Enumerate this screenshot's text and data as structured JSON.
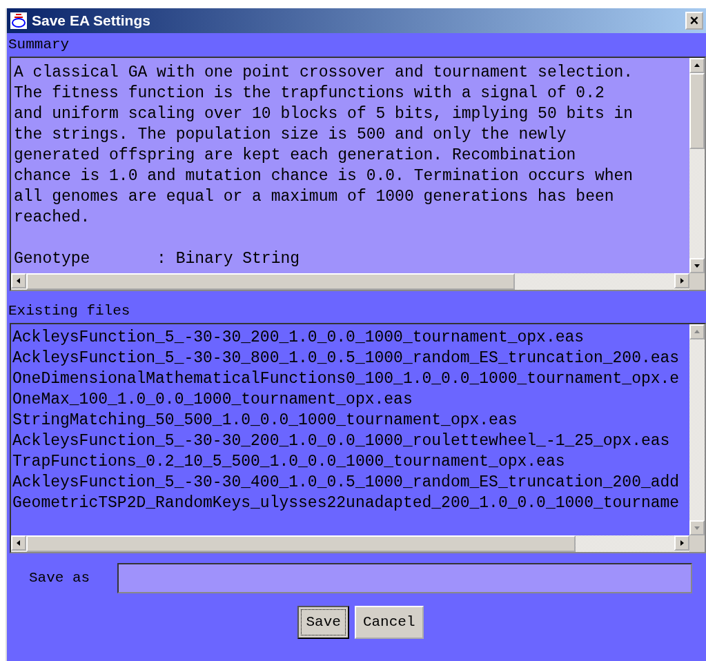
{
  "window": {
    "title": "Save EA Settings",
    "close": "×"
  },
  "summary": {
    "label": "Summary",
    "blocks": [
      [
        "A classical GA with one point crossover and tournament selection.",
        "The fitness function is the trapfunctions with a signal of 0.2",
        "and uniform scaling over 10 blocks of 5 bits, implying 50 bits in",
        "the strings. The population size is 500 and only the newly",
        "generated offspring are kept each generation. Recombination",
        "chance is 1.0 and mutation chance is 0.0. Termination occurs when",
        "all genomes are equal or a maximum of 1000 generations has been",
        "reached."
      ],
      [
        "Genotype       : Binary String"
      ]
    ]
  },
  "files": {
    "label": "Existing files",
    "items": [
      "AckleysFunction_5_-30-30_200_1.0_0.0_1000_tournament_opx.eas",
      "AckleysFunction_5_-30-30_800_1.0_0.5_1000_random_ES_truncation_200.eas",
      "OneDimensionalMathematicalFunctions0_100_1.0_0.0_1000_tournament_opx.e",
      "OneMax_100_1.0_0.0_1000_tournament_opx.eas",
      "StringMatching_50_500_1.0_0.0_1000_tournament_opx.eas",
      "AckleysFunction_5_-30-30_200_1.0_0.0_1000_roulettewheel_-1_25_opx.eas",
      "TrapFunctions_0.2_10_5_500_1.0_0.0_1000_tournament_opx.eas",
      "AckleysFunction_5_-30-30_400_1.0_0.5_1000_random_ES_truncation_200_add",
      "GeometricTSP2D_RandomKeys_ulysses22unadapted_200_1.0_0.0_1000_tourname"
    ]
  },
  "save_as": {
    "label": "Save as"
  },
  "buttons": [
    {
      "label": "Save",
      "focused": true
    },
    {
      "label": "Cancel",
      "focused": false
    }
  ]
}
